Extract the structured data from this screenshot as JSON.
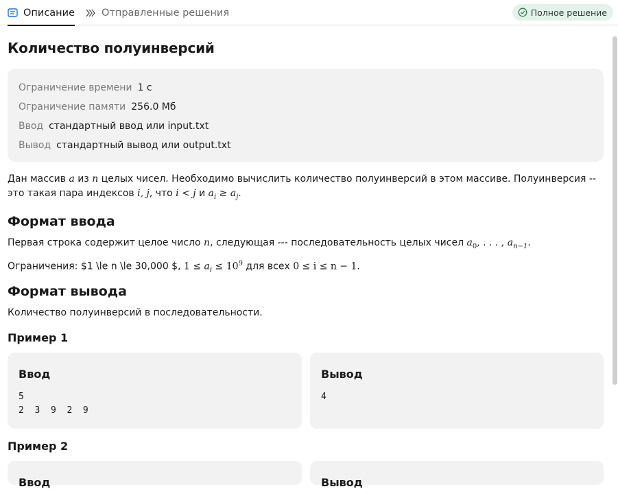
{
  "tabs": {
    "description": "Описание",
    "submissions": "Отправленные решения",
    "status_badge": "Полное решение"
  },
  "problem": {
    "title": "Количество полуинверсий",
    "limits": [
      {
        "label": "Ограничение времени",
        "value": "1 с"
      },
      {
        "label": "Ограничение памяти",
        "value": "256.0 Мб"
      },
      {
        "label": "Ввод",
        "value": "стандартный ввод или input.txt"
      },
      {
        "label": "Вывод",
        "value": "стандартный вывод или output.txt"
      }
    ],
    "statement": {
      "p1a": "Дан массив ",
      "var_a": "a",
      "p1b": " из ",
      "var_n": "n",
      "p1c": " целых чисел. Необходимо вычислить количество полуинверсий в этом массиве. Полуинверсия -- это такая пара индексов ",
      "ij": "i, j",
      "p1d": ", что ",
      "cond1": "i < j",
      "p1e": " и ",
      "a_i": "a",
      "sub_i": "i",
      "ge": " ≥ ",
      "a_j": "a",
      "sub_j": "j",
      "p1f": "."
    },
    "input_format": {
      "heading": "Формат ввода",
      "line1a": "Первая строка содержит целое число ",
      "var_n": "n",
      "line1b": ", следующая --- последовательность целых чисел ",
      "seq_a0": "a",
      "seq_sub0": "0",
      "seq_dots": ", . . . , ",
      "seq_an": "a",
      "seq_subn": "n−1",
      "seq_end": ".",
      "line2a": "Ограничения: $1 \\le n \\le 30,000 $, ",
      "c_one": "1 ≤ ",
      "c_ai": "a",
      "c_sub_i": "i",
      "c_le": " ≤ 10",
      "c_exp": "9",
      "line2b": " для всех ",
      "c_range": "0 ≤ i ≤ n − 1."
    },
    "output_format": {
      "heading": "Формат вывода",
      "text": "Количество полуинверсий в последовательности."
    },
    "examples": [
      {
        "title": "Пример 1",
        "input_label": "Ввод",
        "output_label": "Вывод",
        "input": "5\n2  3  9  2  9",
        "output": "4"
      },
      {
        "title": "Пример 2",
        "input_label": "Ввод",
        "output_label": "Вывод",
        "input": "",
        "output": ""
      }
    ]
  },
  "colors": {
    "badge_bg": "#e3f2ea",
    "panel_bg": "#f2f2f2",
    "muted_text": "#7a7a7a"
  },
  "icons": {
    "description_tab": "list-card-icon",
    "submissions_tab": "double-chevron-icon",
    "badge": "check-circle-icon"
  }
}
